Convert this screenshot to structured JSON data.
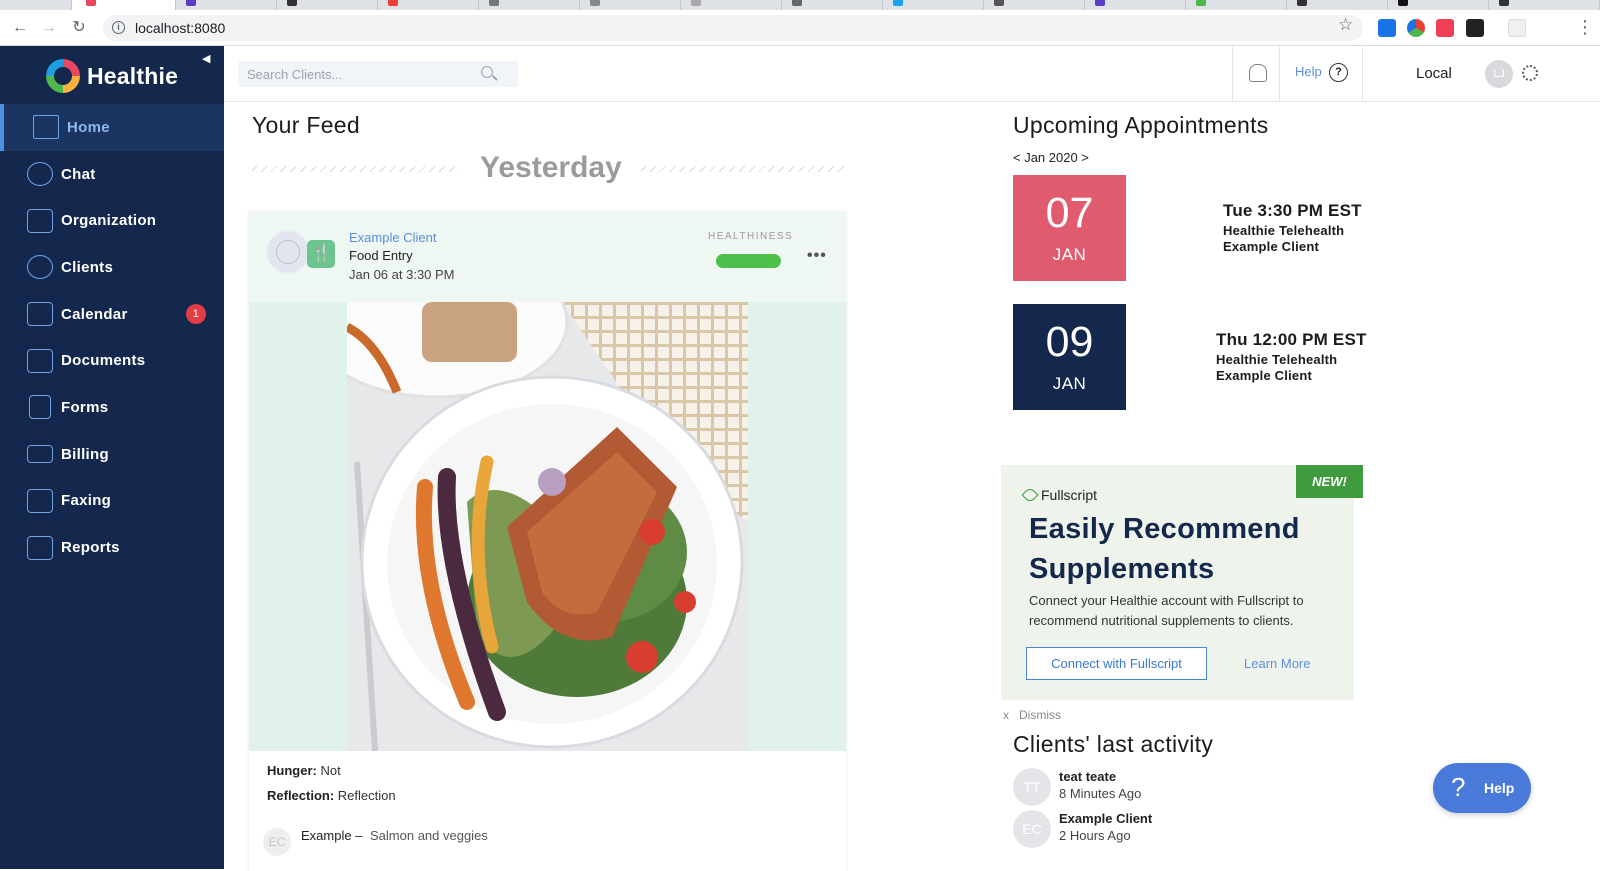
{
  "browser": {
    "url": "localhost:8080",
    "extensions": [
      {
        "name": "translate-extension-icon",
        "color": "#1a73e8"
      },
      {
        "name": "color-picker-extension-icon",
        "color": "#e94235"
      },
      {
        "name": "pocket-extension-icon",
        "color": "#ef4056"
      },
      {
        "name": "qr-extension-icon",
        "color": "#222222"
      },
      {
        "name": "healthie-extension-icon",
        "color": "#f0f0f0"
      }
    ]
  },
  "brand": {
    "name": "Healthie"
  },
  "sidebar": {
    "items": [
      {
        "label": "Home",
        "icon": "home-icon",
        "active": true
      },
      {
        "label": "Chat",
        "icon": "chat-icon"
      },
      {
        "label": "Organization",
        "icon": "building-icon"
      },
      {
        "label": "Clients",
        "icon": "clients-icon"
      },
      {
        "label": "Calendar",
        "icon": "calendar-icon",
        "badge": "1"
      },
      {
        "label": "Documents",
        "icon": "documents-icon"
      },
      {
        "label": "Forms",
        "icon": "forms-icon"
      },
      {
        "label": "Billing",
        "icon": "billing-icon"
      },
      {
        "label": "Faxing",
        "icon": "fax-icon"
      },
      {
        "label": "Reports",
        "icon": "reports-icon"
      }
    ]
  },
  "header": {
    "search_placeholder": "Search Clients...",
    "help_label": "Help",
    "help_icon_glyph": "?",
    "environment": "Local",
    "user_initials": "LJ"
  },
  "feed": {
    "title": "Your Feed",
    "day_divider": "Yesterday",
    "entry": {
      "client": "Example Client",
      "type": "Food Entry",
      "time": "Jan 06 at 3:30 PM",
      "healthiness_label": "HEALTHINESS",
      "healthiness_level": 1.0,
      "hunger_label": "Hunger:",
      "hunger_value": "Not",
      "reflection_label": "Reflection:",
      "reflection_value": "Reflection",
      "comment_initials": "EC",
      "comment_author": "Example –",
      "comment_text": "Salmon and veggies"
    }
  },
  "appointments": {
    "title": "Upcoming Appointments",
    "month_nav": "< Jan 2020 >",
    "items": [
      {
        "day": "07",
        "month": "JAN",
        "time": "Tue 3:30 PM EST",
        "type": "Healthie Telehealth",
        "client": "Example Client",
        "color": "#e15b6e"
      },
      {
        "day": "09",
        "month": "JAN",
        "time": "Thu 12:00 PM EST",
        "type": "Healthie Telehealth",
        "client": "Example Client",
        "color": "#13284c"
      }
    ]
  },
  "promo": {
    "badge": "NEW!",
    "brand": "Fullscript",
    "title": "Easily Recommend Supplements",
    "text": "Connect your Healthie account with Fullscript to recommend nutritional supplements to clients.",
    "button": "Connect with Fullscript",
    "learn_more": "Learn More",
    "dismiss": "x   Dismiss"
  },
  "activity": {
    "title": "Clients' last activity",
    "items": [
      {
        "initials": "TT",
        "name": "teat teate",
        "time": "8 Minutes Ago"
      },
      {
        "initials": "EC",
        "name": "Example Client",
        "time": "2 Hours Ago"
      }
    ]
  },
  "help_button": {
    "glyph": "?",
    "label": "Help"
  }
}
